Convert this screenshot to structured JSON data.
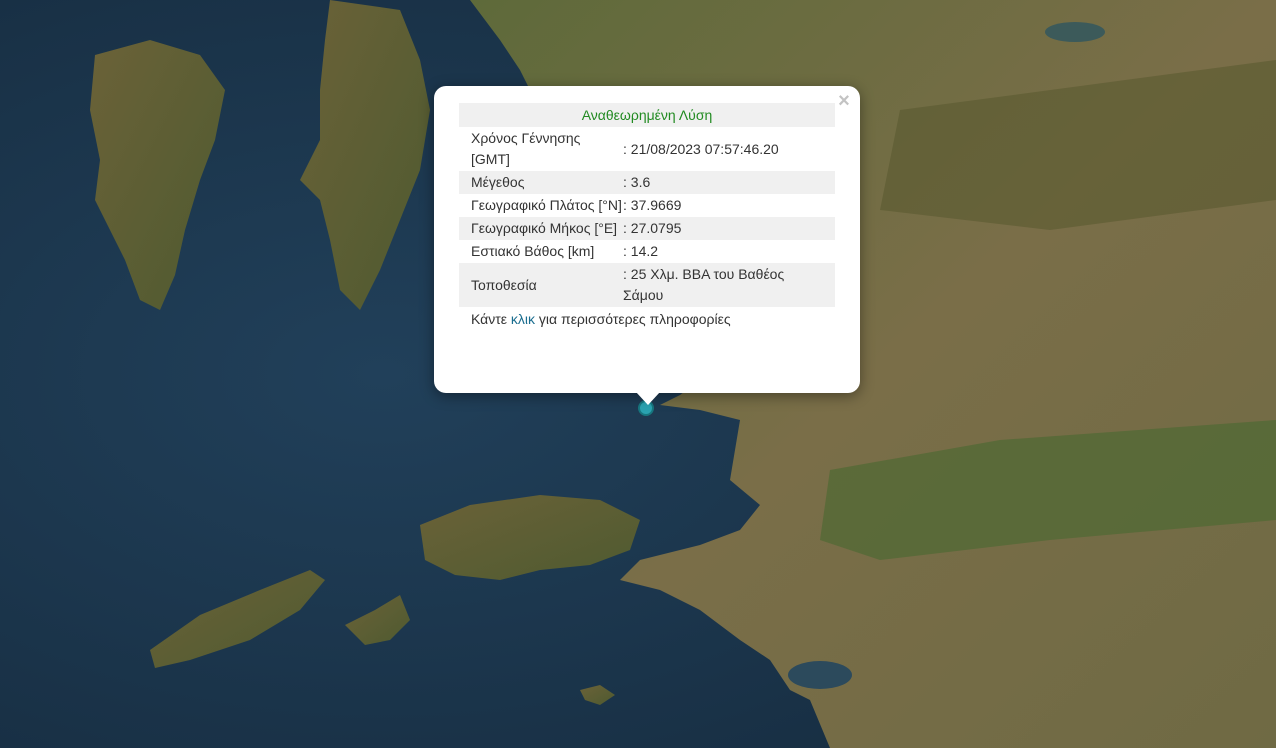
{
  "popup": {
    "title": "Αναθεωρημένη Λύση",
    "close_symbol": "×",
    "rows": [
      {
        "label": "Χρόνος Γέννησης [GMT]",
        "value": ": 21/08/2023 07:57:46.20"
      },
      {
        "label": "Μέγεθος",
        "value": ": 3.6"
      },
      {
        "label": "Γεωγραφικό Πλάτος [°N]",
        "value": ": 37.9669"
      },
      {
        "label": "Γεωγραφικό Μήκος [°E]",
        "value": ": 27.0795"
      },
      {
        "label": "Εστιακό Βάθος [km]",
        "value": ": 14.2"
      },
      {
        "label": "Τοποθεσία",
        "value": ": 25 Χλμ. ΒΒΑ του Βαθέος Σάμου"
      }
    ],
    "more_prefix": "Κάντε ",
    "more_link": "κλικ",
    "more_suffix": " για περισσότερες πληροφορίες"
  },
  "colors": {
    "sea": "#1b3248",
    "land": "#6b6a3f",
    "title": "#228b22",
    "link": "#1a6d8f",
    "marker": "#2aa2b0"
  }
}
